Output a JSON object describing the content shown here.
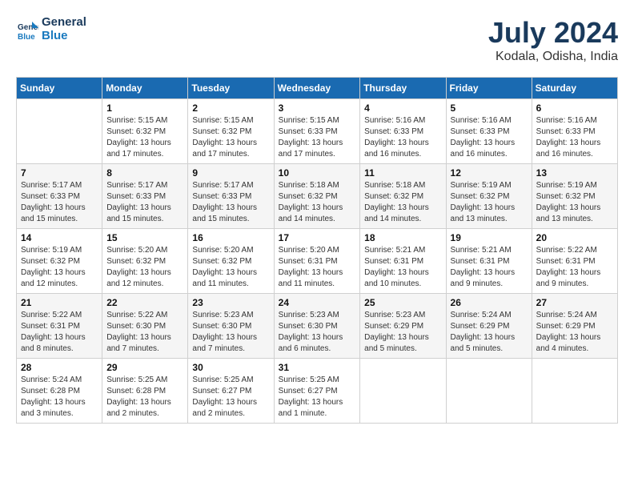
{
  "logo": {
    "line1": "General",
    "line2": "Blue"
  },
  "title": "July 2024",
  "location": "Kodala, Odisha, India",
  "days_of_week": [
    "Sunday",
    "Monday",
    "Tuesday",
    "Wednesday",
    "Thursday",
    "Friday",
    "Saturday"
  ],
  "weeks": [
    [
      {
        "day": "",
        "info": ""
      },
      {
        "day": "1",
        "info": "Sunrise: 5:15 AM\nSunset: 6:32 PM\nDaylight: 13 hours\nand 17 minutes."
      },
      {
        "day": "2",
        "info": "Sunrise: 5:15 AM\nSunset: 6:32 PM\nDaylight: 13 hours\nand 17 minutes."
      },
      {
        "day": "3",
        "info": "Sunrise: 5:15 AM\nSunset: 6:33 PM\nDaylight: 13 hours\nand 17 minutes."
      },
      {
        "day": "4",
        "info": "Sunrise: 5:16 AM\nSunset: 6:33 PM\nDaylight: 13 hours\nand 16 minutes."
      },
      {
        "day": "5",
        "info": "Sunrise: 5:16 AM\nSunset: 6:33 PM\nDaylight: 13 hours\nand 16 minutes."
      },
      {
        "day": "6",
        "info": "Sunrise: 5:16 AM\nSunset: 6:33 PM\nDaylight: 13 hours\nand 16 minutes."
      }
    ],
    [
      {
        "day": "7",
        "info": "Sunrise: 5:17 AM\nSunset: 6:33 PM\nDaylight: 13 hours\nand 15 minutes."
      },
      {
        "day": "8",
        "info": "Sunrise: 5:17 AM\nSunset: 6:33 PM\nDaylight: 13 hours\nand 15 minutes."
      },
      {
        "day": "9",
        "info": "Sunrise: 5:17 AM\nSunset: 6:33 PM\nDaylight: 13 hours\nand 15 minutes."
      },
      {
        "day": "10",
        "info": "Sunrise: 5:18 AM\nSunset: 6:32 PM\nDaylight: 13 hours\nand 14 minutes."
      },
      {
        "day": "11",
        "info": "Sunrise: 5:18 AM\nSunset: 6:32 PM\nDaylight: 13 hours\nand 14 minutes."
      },
      {
        "day": "12",
        "info": "Sunrise: 5:19 AM\nSunset: 6:32 PM\nDaylight: 13 hours\nand 13 minutes."
      },
      {
        "day": "13",
        "info": "Sunrise: 5:19 AM\nSunset: 6:32 PM\nDaylight: 13 hours\nand 13 minutes."
      }
    ],
    [
      {
        "day": "14",
        "info": "Sunrise: 5:19 AM\nSunset: 6:32 PM\nDaylight: 13 hours\nand 12 minutes."
      },
      {
        "day": "15",
        "info": "Sunrise: 5:20 AM\nSunset: 6:32 PM\nDaylight: 13 hours\nand 12 minutes."
      },
      {
        "day": "16",
        "info": "Sunrise: 5:20 AM\nSunset: 6:32 PM\nDaylight: 13 hours\nand 11 minutes."
      },
      {
        "day": "17",
        "info": "Sunrise: 5:20 AM\nSunset: 6:31 PM\nDaylight: 13 hours\nand 11 minutes."
      },
      {
        "day": "18",
        "info": "Sunrise: 5:21 AM\nSunset: 6:31 PM\nDaylight: 13 hours\nand 10 minutes."
      },
      {
        "day": "19",
        "info": "Sunrise: 5:21 AM\nSunset: 6:31 PM\nDaylight: 13 hours\nand 9 minutes."
      },
      {
        "day": "20",
        "info": "Sunrise: 5:22 AM\nSunset: 6:31 PM\nDaylight: 13 hours\nand 9 minutes."
      }
    ],
    [
      {
        "day": "21",
        "info": "Sunrise: 5:22 AM\nSunset: 6:31 PM\nDaylight: 13 hours\nand 8 minutes."
      },
      {
        "day": "22",
        "info": "Sunrise: 5:22 AM\nSunset: 6:30 PM\nDaylight: 13 hours\nand 7 minutes."
      },
      {
        "day": "23",
        "info": "Sunrise: 5:23 AM\nSunset: 6:30 PM\nDaylight: 13 hours\nand 7 minutes."
      },
      {
        "day": "24",
        "info": "Sunrise: 5:23 AM\nSunset: 6:30 PM\nDaylight: 13 hours\nand 6 minutes."
      },
      {
        "day": "25",
        "info": "Sunrise: 5:23 AM\nSunset: 6:29 PM\nDaylight: 13 hours\nand 5 minutes."
      },
      {
        "day": "26",
        "info": "Sunrise: 5:24 AM\nSunset: 6:29 PM\nDaylight: 13 hours\nand 5 minutes."
      },
      {
        "day": "27",
        "info": "Sunrise: 5:24 AM\nSunset: 6:29 PM\nDaylight: 13 hours\nand 4 minutes."
      }
    ],
    [
      {
        "day": "28",
        "info": "Sunrise: 5:24 AM\nSunset: 6:28 PM\nDaylight: 13 hours\nand 3 minutes."
      },
      {
        "day": "29",
        "info": "Sunrise: 5:25 AM\nSunset: 6:28 PM\nDaylight: 13 hours\nand 2 minutes."
      },
      {
        "day": "30",
        "info": "Sunrise: 5:25 AM\nSunset: 6:27 PM\nDaylight: 13 hours\nand 2 minutes."
      },
      {
        "day": "31",
        "info": "Sunrise: 5:25 AM\nSunset: 6:27 PM\nDaylight: 13 hours\nand 1 minute."
      },
      {
        "day": "",
        "info": ""
      },
      {
        "day": "",
        "info": ""
      },
      {
        "day": "",
        "info": ""
      }
    ]
  ]
}
